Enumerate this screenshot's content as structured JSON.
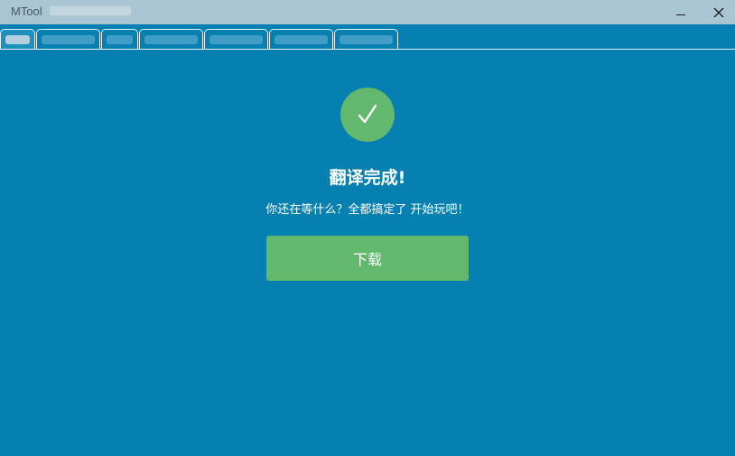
{
  "window": {
    "title": "MTool",
    "minimize_icon": "minimize-icon",
    "close_icon": "close-icon"
  },
  "tabs": [
    {
      "label": "",
      "active": true
    },
    {
      "label": "",
      "active": false
    },
    {
      "label": "",
      "active": false
    },
    {
      "label": "",
      "active": false
    },
    {
      "label": "",
      "active": false
    },
    {
      "label": "",
      "active": false
    },
    {
      "label": "",
      "active": false
    }
  ],
  "main": {
    "icon": "checkmark-icon",
    "headline": "翻译完成!",
    "subtext": "你还在等什么？全都搞定了 开始玩吧！",
    "download_label": "下载"
  },
  "colors": {
    "background": "#0580b0",
    "titlebar": "#a9c5d3",
    "accent_green": "#62b86c",
    "text": "#ffffff"
  }
}
